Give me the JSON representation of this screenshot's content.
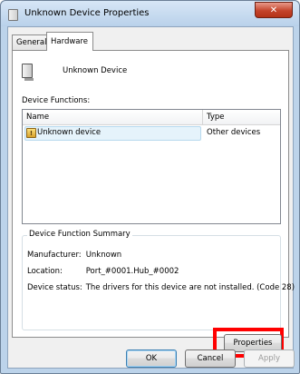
{
  "window": {
    "title": "Unknown Device Properties",
    "close_glyph": "✕"
  },
  "tabs": [
    {
      "label": "General",
      "active": false
    },
    {
      "label": "Hardware",
      "active": true
    }
  ],
  "device": {
    "name": "Unknown Device",
    "icon": "device-icon"
  },
  "functions": {
    "label": "Device Functions:",
    "columns": [
      "Name",
      "Type"
    ],
    "rows": [
      {
        "name": "Unknown device",
        "type": "Other devices",
        "icon": "warning-device-icon",
        "selected": true
      }
    ]
  },
  "summary": {
    "legend": "Device Function Summary",
    "manufacturer_label": "Manufacturer:",
    "manufacturer_value": "Unknown",
    "location_label": "Location:",
    "location_value": "Port_#0001.Hub_#0002",
    "status_label": "Device status:",
    "status_value": "The drivers for this device are not installed. (Code 28)"
  },
  "buttons": {
    "properties": "Properties",
    "ok": "OK",
    "cancel": "Cancel",
    "apply": "Apply"
  },
  "colors": {
    "highlight": "#ff0000",
    "selection": "#e5f3fb"
  }
}
